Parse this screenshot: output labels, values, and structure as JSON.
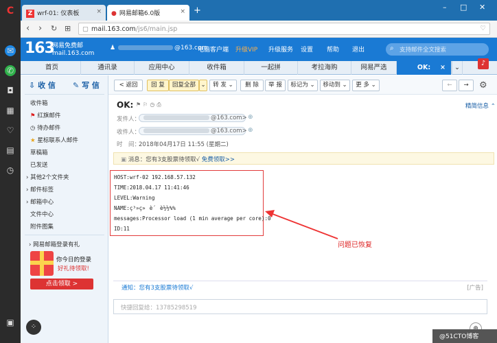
{
  "browser": {
    "tabs": [
      {
        "label": "wrf-01: 仪表板",
        "favicon": "Z"
      },
      {
        "label": "网易邮箱6.0版"
      }
    ],
    "new_tab": "+",
    "url_host": "mail.163.com",
    "url_path": "/js6/main.jsp"
  },
  "mail_header": {
    "logo": "163",
    "logo_line1": "网易免费邮",
    "logo_line2": "mail.163.com",
    "account": "@163.com",
    "links": [
      "电脑客户端",
      "升级VIP",
      "升级服务",
      "设置",
      "帮助",
      "退出"
    ],
    "search_placeholder": "支持邮件全文搜索"
  },
  "mail_tabs": [
    "首页",
    "通讯录",
    "应用中心",
    "收件箱",
    "一起拼",
    "考拉海购",
    "网易严选",
    "OK:"
  ],
  "left_nav": {
    "receive": "收 信",
    "write": "写 信",
    "folders": [
      "收件箱",
      "红旗邮件",
      "待办邮件",
      "星标联系人邮件",
      "草稿箱",
      "已发送",
      "其他2个文件夹",
      "邮件标签",
      "邮箱中心",
      "文件中心",
      "附件图集"
    ],
    "gift_title": "网易邮箱登录有礼",
    "gift_line1": "你今日的登录",
    "gift_line2": "好礼待领取!",
    "gift_button": "点击领取 >"
  },
  "toolbar": {
    "back": "< 返回",
    "reply": "回 复",
    "reply_all": "回复全部",
    "forward": "转 发",
    "delete": "删 除",
    "report": "举 报",
    "mark": "标记为",
    "move": "移动到",
    "more": "更 多"
  },
  "message": {
    "subject": "OK:",
    "from_label": "发件人：",
    "from_value": "@163.com>",
    "to_label": "收件人：",
    "to_value": "@163.com>",
    "time_label": "时　间：",
    "time_value": "2018年04月17日 11:55 (星期二)",
    "simple_info": "精简信息",
    "notice_text": "消息：您有3支股票待领取√",
    "notice_link": "免费领取>>",
    "body_lines": [
      "HOST:wrf-02 192.168.57.132",
      "TIME:2018.04.17  11:41:46",
      "LEVEL:Warning",
      "NAME:ç³»ç»è´è½½%%",
      "messages:Processor load (1 min average per core):0",
      "ID:11"
    ],
    "annotation": "问题已恢复",
    "bottom_notice": "通知：您有3支股票待领取√",
    "ad_label": "[广告]",
    "reply_placeholder": "快捷回复给：13785298519"
  },
  "watermark": "@51CTO博客"
}
